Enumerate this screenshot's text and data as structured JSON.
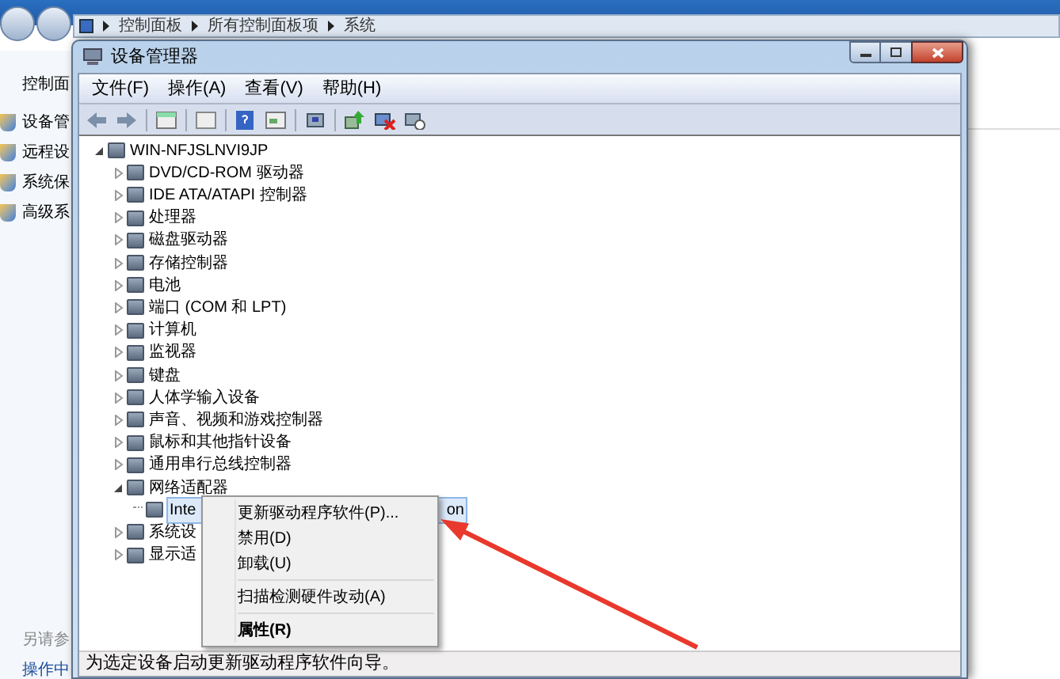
{
  "explorer": {
    "breadcrumbs": [
      "控制面板",
      "所有控制面板项",
      "系统"
    ],
    "sidebar": {
      "home": "控制面",
      "items": [
        "设备管",
        "远程设",
        "系统保",
        "高级系"
      ],
      "see_also": "另请参",
      "links": [
        "操作中"
      ]
    }
  },
  "window": {
    "title": "设备管理器"
  },
  "menu": [
    "文件(F)",
    "操作(A)",
    "查看(V)",
    "帮助(H)"
  ],
  "tree": {
    "label": "WIN-NFJSLNVI9JP",
    "expanded": true,
    "children": [
      {
        "label": "DVD/CD-ROM 驱动器",
        "expanded": false
      },
      {
        "label": "IDE ATA/ATAPI 控制器",
        "expanded": false
      },
      {
        "label": "处理器",
        "expanded": false
      },
      {
        "label": "磁盘驱动器",
        "expanded": false
      },
      {
        "label": "存储控制器",
        "expanded": false
      },
      {
        "label": "电池",
        "expanded": false
      },
      {
        "label": "端口 (COM 和 LPT)",
        "expanded": false
      },
      {
        "label": "计算机",
        "expanded": false
      },
      {
        "label": "监视器",
        "expanded": false
      },
      {
        "label": "键盘",
        "expanded": false
      },
      {
        "label": "人体学输入设备",
        "expanded": false
      },
      {
        "label": "声音、视频和游戏控制器",
        "expanded": false
      },
      {
        "label": "鼠标和其他指针设备",
        "expanded": false
      },
      {
        "label": "通用串行总线控制器",
        "expanded": false
      },
      {
        "label": "网络适配器",
        "expanded": true,
        "children": [
          {
            "label": "Inte",
            "label_end": "on",
            "selected": true
          }
        ]
      },
      {
        "label": "系统设",
        "expanded": false
      },
      {
        "label": "显示适",
        "expanded": false
      }
    ]
  },
  "context_menu": [
    {
      "label": "更新驱动程序软件(P)...",
      "bold": false
    },
    {
      "label": "禁用(D)",
      "bold": false
    },
    {
      "label": "卸载(U)",
      "bold": false,
      "separator_after": true
    },
    {
      "label": "扫描检测硬件改动(A)",
      "bold": false,
      "separator_after": true
    },
    {
      "label": "属性(R)",
      "bold": true
    }
  ],
  "status_bar": "为选定设备启动更新驱动程序软件向导。"
}
